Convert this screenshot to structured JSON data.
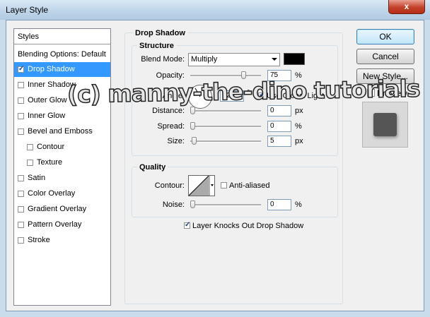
{
  "window": {
    "title": "Layer Style",
    "close_label": "x"
  },
  "sidebar": {
    "header": "Styles",
    "blending_options": "Blending Options: Default",
    "items": [
      {
        "label": "Drop Shadow",
        "checked": true,
        "selected": true,
        "indent": false
      },
      {
        "label": "Inner Shadow",
        "checked": false,
        "selected": false,
        "indent": false
      },
      {
        "label": "Outer Glow",
        "checked": false,
        "selected": false,
        "indent": false
      },
      {
        "label": "Inner Glow",
        "checked": false,
        "selected": false,
        "indent": false
      },
      {
        "label": "Bevel and Emboss",
        "checked": false,
        "selected": false,
        "indent": false
      },
      {
        "label": "Contour",
        "checked": false,
        "selected": false,
        "indent": true
      },
      {
        "label": "Texture",
        "checked": false,
        "selected": false,
        "indent": true
      },
      {
        "label": "Satin",
        "checked": false,
        "selected": false,
        "indent": false
      },
      {
        "label": "Color Overlay",
        "checked": false,
        "selected": false,
        "indent": false
      },
      {
        "label": "Gradient Overlay",
        "checked": false,
        "selected": false,
        "indent": false
      },
      {
        "label": "Pattern Overlay",
        "checked": false,
        "selected": false,
        "indent": false
      },
      {
        "label": "Stroke",
        "checked": false,
        "selected": false,
        "indent": false
      }
    ]
  },
  "panel": {
    "title": "Drop Shadow",
    "structure": {
      "legend": "Structure",
      "blend_mode_label": "Blend Mode:",
      "blend_mode_value": "Multiply",
      "shadow_color": "#000000",
      "opacity_label": "Opacity:",
      "opacity_value": "75",
      "opacity_unit": "%",
      "opacity_level": 0.75,
      "angle_label": "Angle:",
      "angle_value": "120",
      "angle_unit": "°",
      "use_global_light_label": "Use Global Light",
      "use_global_light_checked": true,
      "distance_label": "Distance:",
      "distance_value": "0",
      "distance_unit": "px",
      "spread_label": "Spread:",
      "spread_value": "0",
      "spread_unit": "%",
      "size_label": "Size:",
      "size_value": "5",
      "size_unit": "px"
    },
    "quality": {
      "legend": "Quality",
      "contour_label": "Contour:",
      "anti_aliased_label": "Anti-aliased",
      "anti_aliased_checked": false,
      "noise_label": "Noise:",
      "noise_value": "0",
      "noise_unit": "%"
    },
    "layer_knocks_out_label": "Layer Knocks Out Drop Shadow",
    "layer_knocks_out_checked": true
  },
  "buttons": {
    "ok": "OK",
    "cancel": "Cancel",
    "new_style": "New Style...",
    "preview_label": "Preview",
    "preview_checked": true
  },
  "watermark": "(c) manny-the-dino tutorials",
  "colors": {
    "selection": "#3399ff",
    "preview_square": "#555555"
  }
}
